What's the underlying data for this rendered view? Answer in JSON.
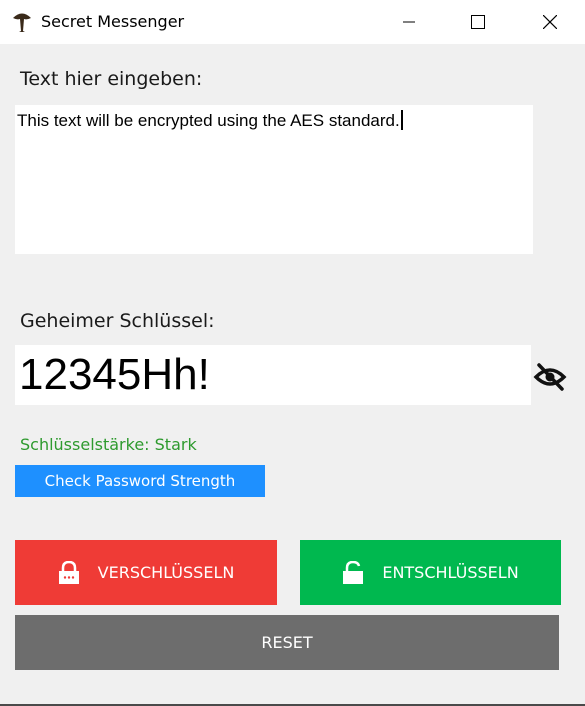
{
  "window": {
    "title": "Secret Messenger",
    "icon": "mushroom-icon"
  },
  "message": {
    "label": "Text hier eingeben:",
    "value": "This text will be encrypted using the AES standard."
  },
  "key": {
    "label": "Geheimer Schlüssel:",
    "value": "12345Hh!",
    "toggle_icon": "eye-slash-icon"
  },
  "strength": {
    "text": "Schlüsselstärke: Stark",
    "color": "#2e9a2e"
  },
  "buttons": {
    "check": "Check Password Strength",
    "encrypt": "VERSCHLÜSSELN",
    "decrypt": "ENTSCHLÜSSELN",
    "reset": "RESET"
  },
  "colors": {
    "check": "#1e90ff",
    "encrypt": "#ef3b36",
    "decrypt": "#00b84f",
    "reset": "#6d6d6d"
  }
}
